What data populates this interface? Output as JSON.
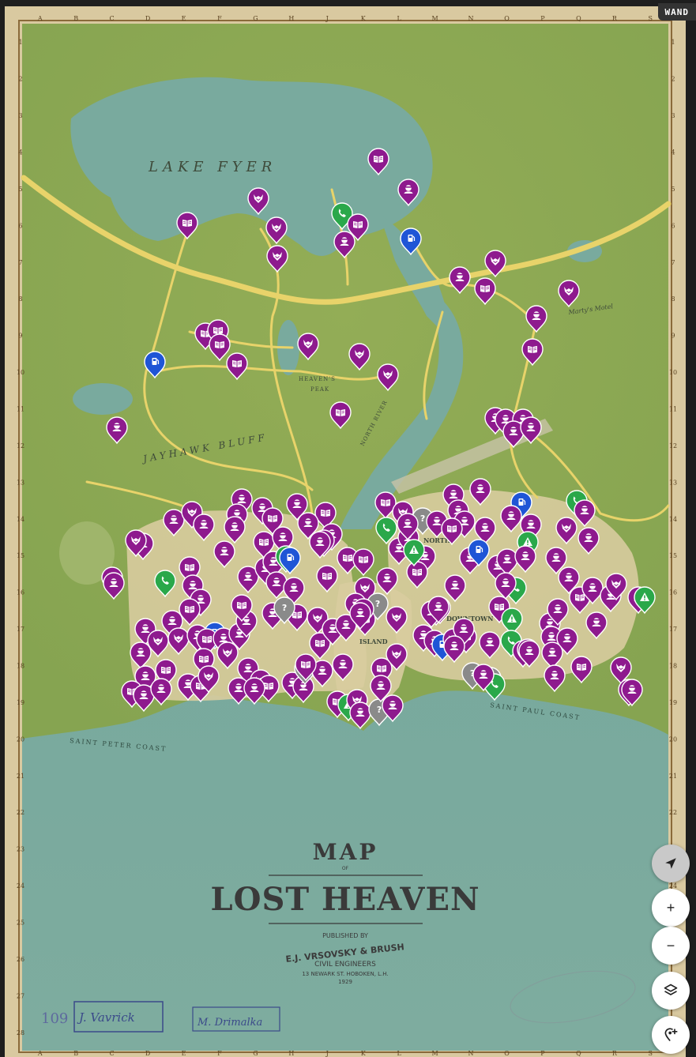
{
  "map": {
    "labels": {
      "lake": "LAKE FYER",
      "bluff": "JAYHAWK BLUFF",
      "peak_1": "HEAVEN'S",
      "peak_2": "PEAK",
      "north_river": "NORTH RIVER",
      "north": "NORTH",
      "downtown": "DOWNTOWN",
      "island": "ISLAND",
      "saint_peter": "SAINT PETER COAST",
      "saint_paul": "SAINT PAUL COAST",
      "motel": "Marty's Motel"
    },
    "title_map": "MAP",
    "title_of": "OF",
    "title_main": "LOST HEAVEN",
    "published_by": "PUBLISHED BY",
    "publisher": "E.J. VRSOVSKY & BRUSH",
    "engineers": "CIVIL ENGINEERS",
    "address": "13 NEWARK ST. HOBOKEN, L.H.",
    "year": "1929",
    "stamp_number": "109",
    "signature_1": "J. Vavrick",
    "signature_2": "M. Drimalka",
    "col_letters": [
      "A",
      "B",
      "C",
      "D",
      "E",
      "F",
      "G",
      "H",
      "J",
      "K",
      "L",
      "M",
      "N",
      "O",
      "P",
      "Q",
      "R",
      "S"
    ],
    "row_numbers": [
      "1",
      "2",
      "3",
      "4",
      "5",
      "6",
      "7",
      "8",
      "9",
      "10",
      "11",
      "12",
      "13",
      "14",
      "15",
      "16",
      "17",
      "18",
      "19",
      "20",
      "21",
      "22",
      "23",
      "24",
      "25",
      "26",
      "27",
      "28"
    ],
    "colors": {
      "collectible": "#8e1a8e",
      "gas_station": "#1f55d6",
      "phone": "#2aa84a",
      "mystery": "#8a8a8a",
      "land": "#8fab55",
      "water": "#79aa9e",
      "road": "#e8d36a"
    }
  },
  "controls": {
    "logo": "WAND",
    "locate_icon": "navigation-arrow-icon",
    "zoom_in": "+",
    "zoom_out": "−",
    "layers_icon": "layers-icon",
    "add_marker_icon": "add-location-icon"
  }
}
